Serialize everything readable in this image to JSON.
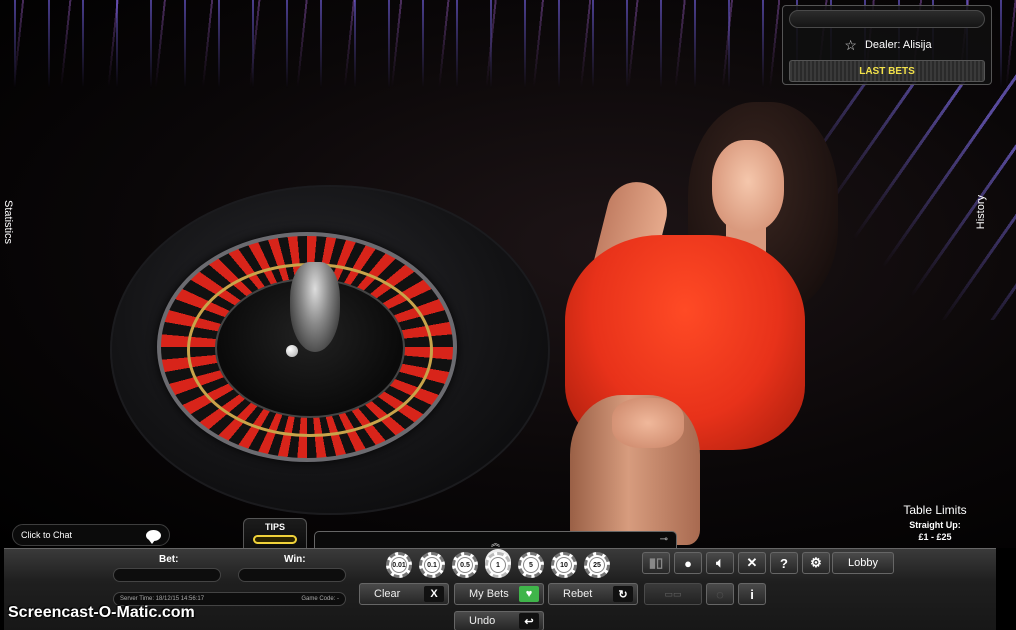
{
  "side_tabs": {
    "statistics": "Statistics",
    "history": "History"
  },
  "dealer_panel": {
    "dealer_text": "Dealer: Alisija",
    "last_bets": "LAST BETS"
  },
  "table_limits": {
    "title": "Table Limits",
    "subtitle": "Straight Up:",
    "range": "£1 - £25"
  },
  "chat": {
    "label": "Click to Chat"
  },
  "tips": {
    "label": "TIPS"
  },
  "fields": {
    "bet_label": "Bet:",
    "win_label": "Win:",
    "server_time": "Server Time: 18/12/15 14:56:17",
    "game_code": "Game Code: -"
  },
  "chips": [
    "0.01",
    "0.1",
    "0.5",
    "1",
    "5",
    "10",
    "25"
  ],
  "selected_chip": "1",
  "buttons": {
    "clear": "Clear",
    "clear_icon": "X",
    "my_bets": "My Bets",
    "rebet": "Rebet",
    "undo": "Undo",
    "lobby": "Lobby",
    "help": "?",
    "info": "i"
  },
  "icons": {
    "star": "star-icon",
    "chat": "chat-bubble-icon",
    "pin": "pin-icon",
    "sound": "speaker-icon",
    "fullscreen": "fullscreen-icon",
    "settings": "gear-icon",
    "rebet": "repeat-icon",
    "undo": "undo-icon",
    "my_bets": "heart-icon"
  },
  "colors": {
    "last_bets_text": "#f2e14a",
    "my_bets_icon": "#3fb54a",
    "tips_accent": "#f0d23a",
    "dress": "#e8321a"
  },
  "watermark": "Screencast-O-Matic.com"
}
